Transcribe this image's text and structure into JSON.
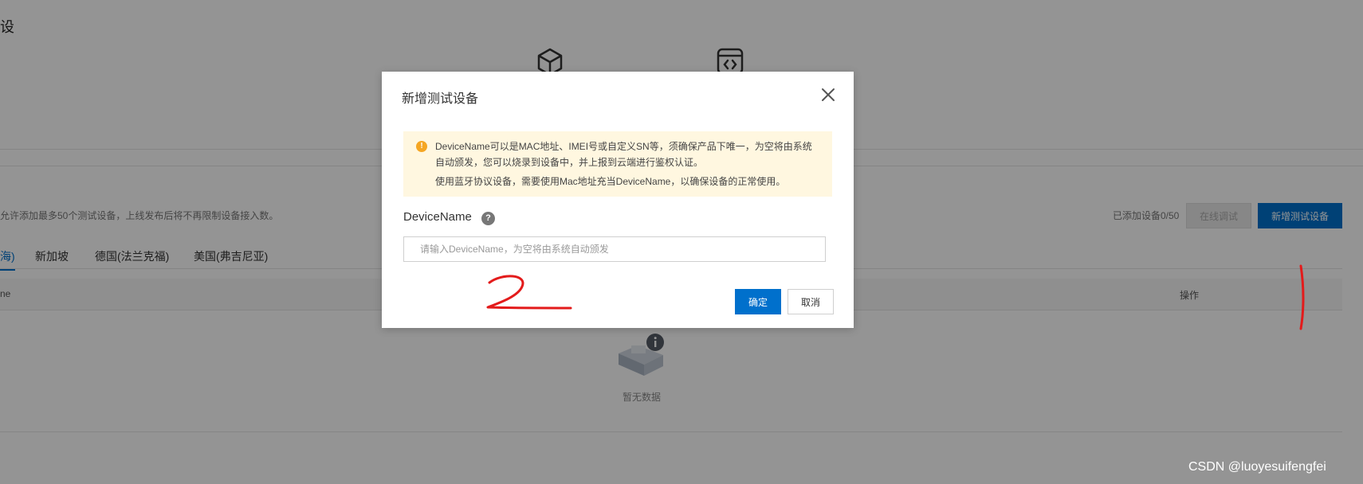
{
  "background": {
    "title_fragment": "设",
    "note": "允许添加最多50个测试设备，上线发布后将不再限制设备接入数。",
    "device_count": "已添加设备0/50",
    "online_debug_button": "在线调试",
    "add_device_button": "新增测试设备",
    "tabs": [
      {
        "label": "海)"
      },
      {
        "label": "新加坡"
      },
      {
        "label": "德国(法兰克福)"
      },
      {
        "label": "美国(弗吉尼亚)"
      }
    ],
    "table_headers": {
      "first": "ne",
      "actions": "操作"
    },
    "empty_text": "暂无数据",
    "icons": [
      "cube-icon",
      "code-window-icon",
      "empty-box-icon"
    ]
  },
  "dialog": {
    "title": "新增测试设备",
    "alert": {
      "line1": "DeviceName可以是MAC地址、IMEI号或自定义SN等，须确保产品下唯一，为空将由系统",
      "line2": "自动颁发，您可以烧录到设备中，并上报到云端进行鉴权认证。",
      "line3": "使用蓝牙协议设备，需要使用Mac地址充当DeviceName，以确保设备的正常使用。"
    },
    "field_label": "DeviceName",
    "input_placeholder": "请输入DeviceName，为空将由系统自动颁发",
    "input_value": "",
    "ok_button": "确定",
    "cancel_button": "取消"
  },
  "annotations": {
    "handwritten_marks": [
      "1",
      "2"
    ],
    "color": "#e31b1b"
  },
  "watermark": "CSDN @luoyesuifengfei",
  "colors": {
    "primary": "#0070cc",
    "alert_bg": "#fff7e0",
    "warning": "#f5a623"
  }
}
